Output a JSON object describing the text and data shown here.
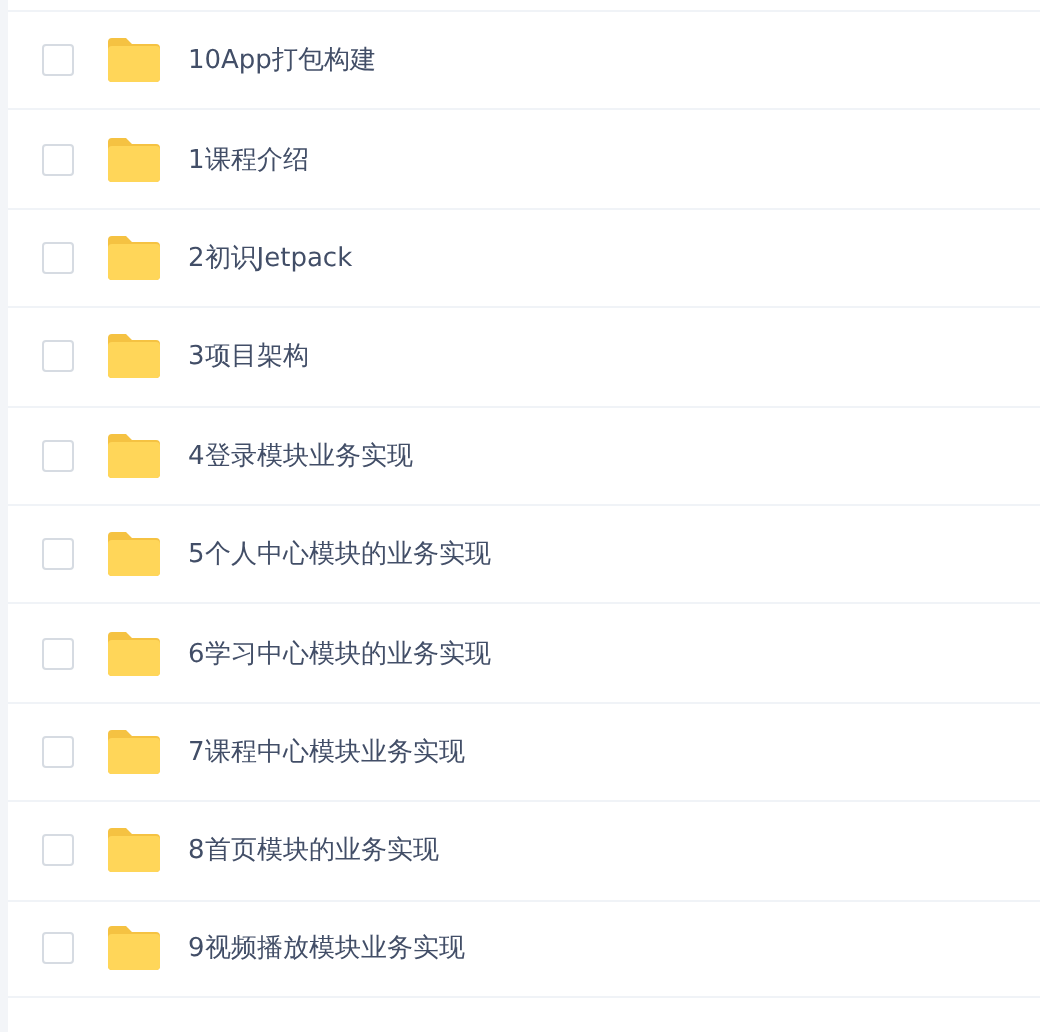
{
  "files": [
    {
      "name": "10App打包构建",
      "checked": false
    },
    {
      "name": "1课程介绍",
      "checked": false
    },
    {
      "name": "2初识Jetpack",
      "checked": false
    },
    {
      "name": "3项目架构",
      "checked": false
    },
    {
      "name": "4登录模块业务实现",
      "checked": false
    },
    {
      "name": "5个人中心模块的业务实现",
      "checked": false
    },
    {
      "name": "6学习中心模块的业务实现",
      "checked": false
    },
    {
      "name": "7课程中心模块业务实现",
      "checked": false
    },
    {
      "name": "8首页模块的业务实现",
      "checked": false
    },
    {
      "name": "9视频播放模块业务实现",
      "checked": false
    }
  ]
}
